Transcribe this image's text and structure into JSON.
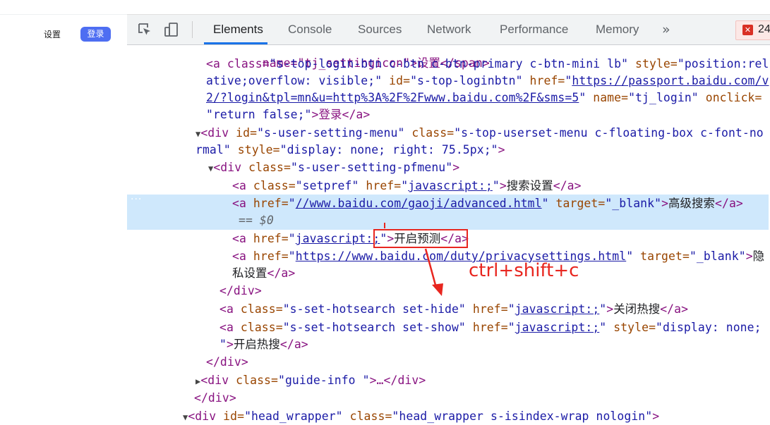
{
  "page": {
    "settings_link": "设置",
    "login_button": "登录"
  },
  "devtools": {
    "tabs": [
      "Elements",
      "Console",
      "Sources",
      "Network",
      "Performance",
      "Memory"
    ],
    "active_tab": "Elements",
    "more_tabs_icon": "»",
    "error_count": "24",
    "icons": [
      "inspect-element-icon",
      "device-toolbar-icon",
      "more-tabs-icon",
      "error-icon"
    ],
    "colors": {
      "tag": "#881280",
      "attr_name": "#994500",
      "attr_value": "#1a1aa6",
      "selection": "#cfe8fc",
      "accent": "#1a73e8",
      "annotation": "#e8261f"
    }
  },
  "tree": {
    "line1": "name=\"tj_settingicon\">设置</span>",
    "line2": {
      "a": "<a class=",
      "b": "\"s-top-login-btn c-btn c-btn-primary c-btn-mini lb\"",
      "c": " style=",
      "d": "\"position:rel"
    },
    "line3": {
      "a": "ative;overflow: visible;\"",
      "b": " id=",
      "c": "\"s-top-loginbtn\"",
      "d": " href=",
      "e": "\"",
      "f": "https://passport.baidu.com/v"
    },
    "line4": {
      "a": "2/?login&tpl=mn&u=http%3A%2F%2Fwww.baidu.com%2F&sms=5",
      "b": "\"",
      "c": " name=",
      "d": "\"tj_login\"",
      "e": " onclick="
    },
    "line5": {
      "a": "\"return false;\"",
      "b": ">登录</a>"
    },
    "line6": {
      "a": "<div",
      "b": " id=",
      "c": "\"s-user-setting-menu\"",
      "d": " class=",
      "e": "\"s-top-userset-menu c-floating-box c-font-no"
    },
    "line7": {
      "a": "rmal\"",
      "b": " style=",
      "c": "\"display: none; right: 75.5px;\"",
      "d": ">"
    },
    "line8": {
      "a": "<div",
      "b": " class=",
      "c": "\"s-user-setting-pfmenu\"",
      "d": ">"
    },
    "line9": {
      "a": "<a",
      "b": " class=",
      "c": "\"setpref\"",
      "d": " href=",
      "e": "\"",
      "f": "javascript:;",
      "g": "\"",
      "h": ">",
      "i": "搜索设置",
      "j": "</a>"
    },
    "line10": {
      "a": "<a",
      "b": " href=",
      "c": "\"",
      "d": "//www.baidu.com/gaoji/advanced.html",
      "e": "\"",
      "f": " target=",
      "g": "\"_blank\"",
      "h": ">",
      "i": "高级搜索",
      "j": "</a>"
    },
    "line11": "== $0",
    "line12": {
      "a": "<a",
      "b": " href=",
      "c": "\"",
      "d": "javascript:;",
      "e": "\"",
      "f": ">",
      "g": "开启预测",
      "h": "</a>"
    },
    "line13": {
      "a": "<a",
      "b": " href=",
      "c": "\"",
      "d": "https://www.baidu.com/duty/privacysettings.html",
      "e": "\"",
      "f": " target=",
      "g": "\"_blank\"",
      "h": ">",
      "i": "隐"
    },
    "line14": {
      "a": "私设置",
      "b": "</a>"
    },
    "line15": "</div>",
    "line16": {
      "a": "<a",
      "b": " class=",
      "c": "\"s-set-hotsearch set-hide\"",
      "d": " href=",
      "e": "\"",
      "f": "javascript:;",
      "g": "\"",
      "h": ">",
      "i": "关闭热搜",
      "j": "</a>"
    },
    "line17": {
      "a": "<a",
      "b": " class=",
      "c": "\"s-set-hotsearch set-show\"",
      "d": " href=",
      "e": "\"",
      "f": "javascript:;",
      "g": "\"",
      "h": " style=",
      "i": "\"display: none;"
    },
    "line18": {
      "a": "\"",
      "b": ">",
      "c": "开启热搜",
      "d": "</a>"
    },
    "line19": "</div>",
    "line20": {
      "a": "<div",
      "b": " class=",
      "c": "\"guide-info \"",
      "d": ">…</div>"
    },
    "line21": "</div>",
    "line22": {
      "a": "<div",
      "b": " id=",
      "c": "\"head_wrapper\"",
      "d": " class=",
      "e": "\"head_wrapper s-isindex-wrap nologin\"",
      "f": ">"
    },
    "selection_dots": "···"
  },
  "annotation": {
    "shortcut": "ctrl+shift+c"
  }
}
